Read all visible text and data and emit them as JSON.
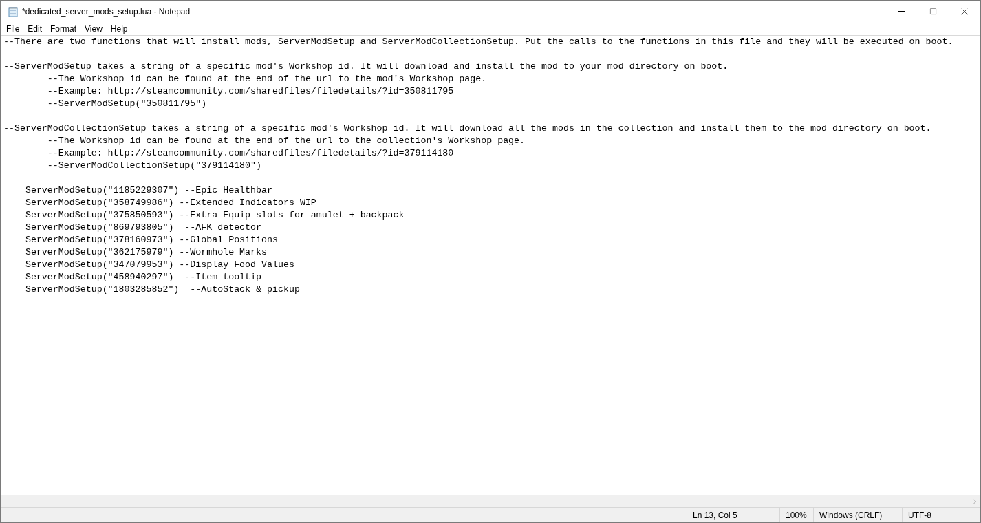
{
  "window": {
    "title": "*dedicated_server_mods_setup.lua - Notepad"
  },
  "menu": [
    "File",
    "Edit",
    "Format",
    "View",
    "Help"
  ],
  "editor": {
    "blocks": [
      [
        "--There are two functions that will install mods, ServerModSetup and ServerModCollectionSetup. Put the calls to the functions in this file and they will be executed on boot."
      ],
      [
        "--ServerModSetup takes a string of a specific mod's Workshop id. It will download and install the mod to your mod directory on boot.",
        "\t--The Workshop id can be found at the end of the url to the mod's Workshop page.",
        "\t--Example: http://steamcommunity.com/sharedfiles/filedetails/?id=350811795",
        "\t--ServerModSetup(\"350811795\")"
      ],
      [
        "--ServerModCollectionSetup takes a string of a specific mod's Workshop id. It will download all the mods in the collection and install them to the mod directory on boot.",
        "\t--The Workshop id can be found at the end of the url to the collection's Workshop page.",
        "\t--Example: http://steamcommunity.com/sharedfiles/filedetails/?id=379114180",
        "\t--ServerModCollectionSetup(\"379114180\")"
      ],
      [
        "    ServerModSetup(\"1185229307\") --Epic Healthbar",
        "    ServerModSetup(\"358749986\") --Extended Indicators WIP",
        "    ServerModSetup(\"375850593\") --Extra Equip slots for amulet + backpack",
        "    ServerModSetup(\"869793805\")  --AFK detector",
        "    ServerModSetup(\"378160973\") --Global Positions",
        "    ServerModSetup(\"362175979\") --Wormhole Marks",
        "    ServerModSetup(\"347079953\") --Display Food Values",
        "    ServerModSetup(\"458940297\")  --Item tooltip",
        "    ServerModSetup(\"1803285852\")  --AutoStack & pickup"
      ]
    ]
  },
  "status_bar": [
    "Ln 13, Col 5",
    "100%",
    "Windows (CRLF)",
    "UTF-8"
  ]
}
